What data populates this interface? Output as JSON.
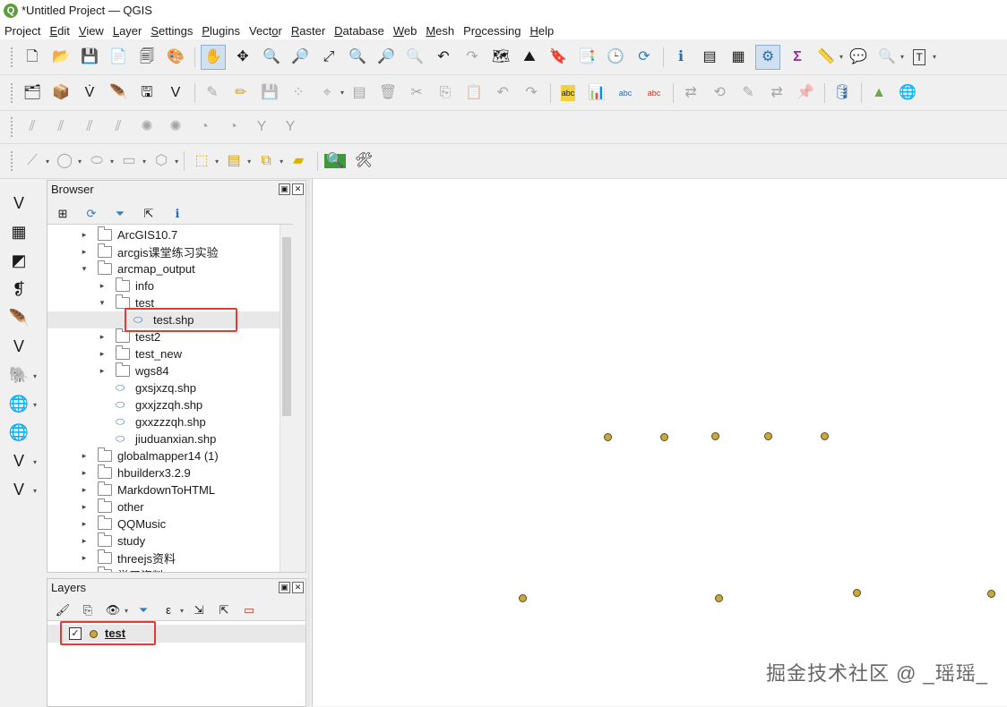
{
  "window": {
    "title": "*Untitled Project — QGIS",
    "app_icon_letter": "Q"
  },
  "menubar": [
    {
      "label": "Project",
      "key": ""
    },
    {
      "label": "Edit",
      "key": "E"
    },
    {
      "label": "View",
      "key": "V"
    },
    {
      "label": "Layer",
      "key": "L"
    },
    {
      "label": "Settings",
      "key": "S"
    },
    {
      "label": "Plugins",
      "key": "P"
    },
    {
      "label": "Vector",
      "key": "o"
    },
    {
      "label": "Raster",
      "key": "R"
    },
    {
      "label": "Database",
      "key": "D"
    },
    {
      "label": "Web",
      "key": "W"
    },
    {
      "label": "Mesh",
      "key": "M"
    },
    {
      "label": "Processing",
      "key": "o"
    },
    {
      "label": "Help",
      "key": "H"
    }
  ],
  "browser": {
    "title": "Browser",
    "items": [
      {
        "label": "ArcGIS10.7",
        "level": 1,
        "arrow": "▸",
        "type": "folder"
      },
      {
        "label": "arcgis课堂练习实验",
        "level": 1,
        "arrow": "▸",
        "type": "folder"
      },
      {
        "label": "arcmap_output",
        "level": 1,
        "arrow": "▾",
        "type": "folder"
      },
      {
        "label": "info",
        "level": 2,
        "arrow": "▸",
        "type": "folder"
      },
      {
        "label": "test",
        "level": 2,
        "arrow": "▾",
        "type": "folder"
      },
      {
        "label": "test.shp",
        "level": 3,
        "arrow": "",
        "type": "shp",
        "selected": true
      },
      {
        "label": "test2",
        "level": 2,
        "arrow": "▸",
        "type": "folder"
      },
      {
        "label": "test_new",
        "level": 2,
        "arrow": "▸",
        "type": "folder"
      },
      {
        "label": "wgs84",
        "level": 2,
        "arrow": "▸",
        "type": "folder"
      },
      {
        "label": "gxsjxzq.shp",
        "level": 2,
        "arrow": "",
        "type": "shp"
      },
      {
        "label": "gxxjzzqh.shp",
        "level": 2,
        "arrow": "",
        "type": "shp"
      },
      {
        "label": "gxxzzzqh.shp",
        "level": 2,
        "arrow": "",
        "type": "shp"
      },
      {
        "label": "jiuduanxian.shp",
        "level": 2,
        "arrow": "",
        "type": "shp"
      },
      {
        "label": "globalmapper14 (1)",
        "level": 1,
        "arrow": "▸",
        "type": "folder"
      },
      {
        "label": "hbuilderx3.2.9",
        "level": 1,
        "arrow": "▸",
        "type": "folder"
      },
      {
        "label": "MarkdownToHTML",
        "level": 1,
        "arrow": "▸",
        "type": "folder"
      },
      {
        "label": "other",
        "level": 1,
        "arrow": "▸",
        "type": "folder"
      },
      {
        "label": "QQMusic",
        "level": 1,
        "arrow": "▸",
        "type": "folder"
      },
      {
        "label": "study",
        "level": 1,
        "arrow": "▸",
        "type": "folder"
      },
      {
        "label": "threejs资料",
        "level": 1,
        "arrow": "▸",
        "type": "folder"
      },
      {
        "label": "学习资料",
        "level": 1,
        "arrow": "▸",
        "type": "folder"
      }
    ]
  },
  "layers": {
    "title": "Layers",
    "items": [
      {
        "label": "test",
        "checked": true,
        "check_mark": "✓"
      }
    ]
  },
  "canvas": {
    "point_color": "#c9a83d",
    "highlight_color": "#e53935"
  },
  "watermark": "掘金技术社区 @ _瑶瑶_"
}
